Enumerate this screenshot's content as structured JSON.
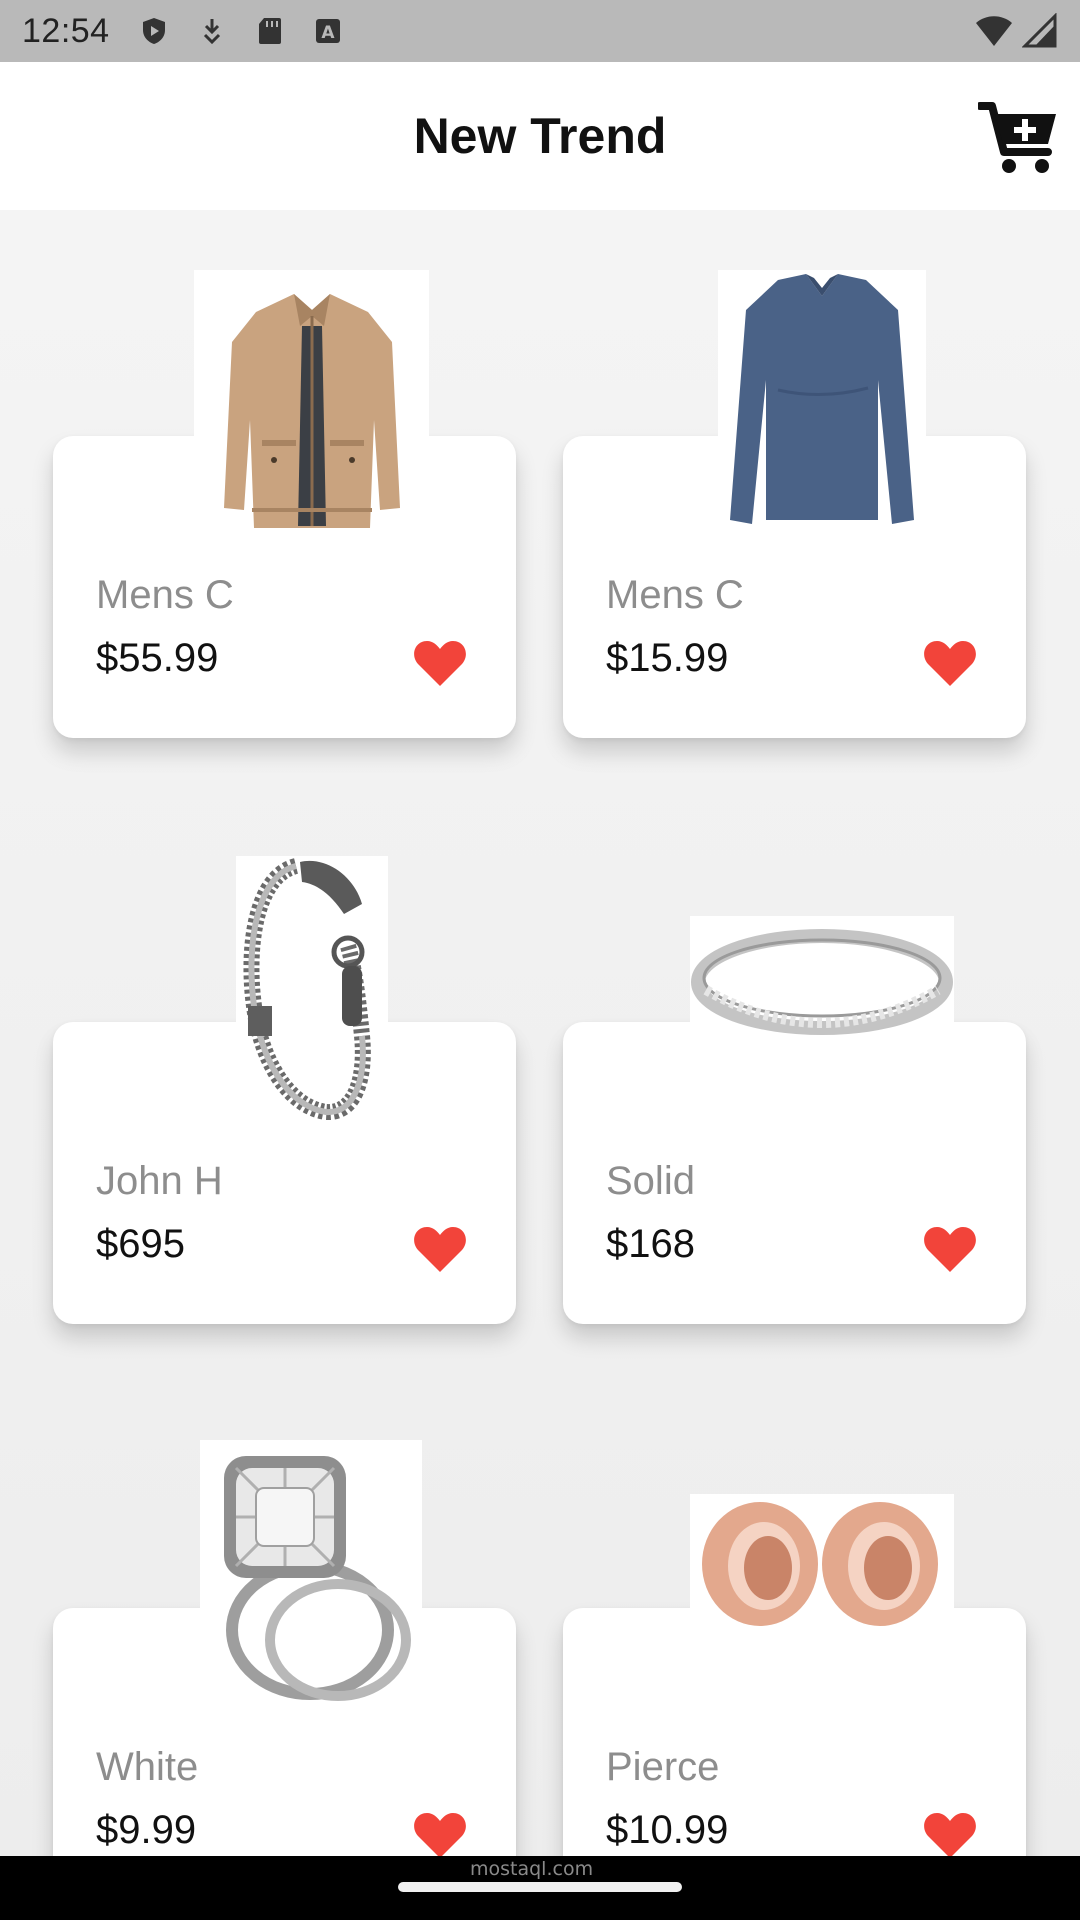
{
  "status_bar": {
    "time": "12:54",
    "icons_left": [
      "shield-play-icon",
      "download-arrow-icon",
      "sd-card-icon",
      "keyboard-a-icon"
    ],
    "icons_right": [
      "wifi-icon",
      "cellular-signal-icon"
    ]
  },
  "app_bar": {
    "title": "New Trend",
    "cart_icon": "cart-plus-icon"
  },
  "colors": {
    "heart": "#f2443a",
    "name_text": "#8d8d8d",
    "price_text": "#111111",
    "card_bg": "#ffffff",
    "page_bg": "#f2f2f2"
  },
  "products": [
    {
      "name": "Mens C",
      "price": "$55.99",
      "image": "khaki-jacket",
      "favorite": true
    },
    {
      "name": "Mens C",
      "price": "$15.99",
      "image": "blue-longsleeve-shirt",
      "favorite": true
    },
    {
      "name": "John H",
      "price": "$695",
      "image": "silver-dragon-bracelet",
      "favorite": true
    },
    {
      "name": "Solid",
      "price": "$168",
      "image": "diamond-band-ring",
      "favorite": true
    },
    {
      "name": "White",
      "price": "$9.99",
      "image": "cushion-diamond-ring-set",
      "favorite": true
    },
    {
      "name": "Pierce",
      "price": "$10.99",
      "image": "rose-gold-ear-tunnels",
      "favorite": true
    }
  ],
  "watermark": "mostaql.com"
}
